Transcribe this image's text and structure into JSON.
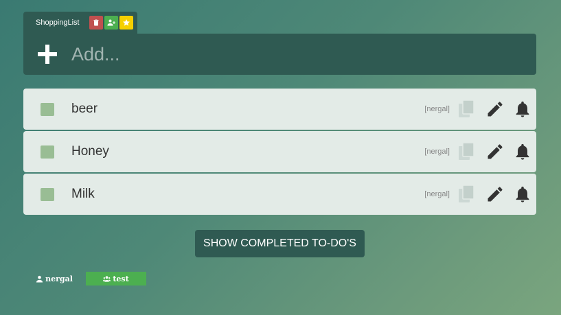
{
  "tab": {
    "title": "ShoppingList",
    "buttons": [
      {
        "name": "delete",
        "icon": "trash-icon",
        "color": "#c0504f"
      },
      {
        "name": "share",
        "icon": "user-plus-icon",
        "color": "#4caf50"
      },
      {
        "name": "favorite",
        "icon": "star-icon",
        "color": "#f5d000"
      }
    ]
  },
  "add": {
    "placeholder": "Add...",
    "icon": "plus-icon"
  },
  "todos": [
    {
      "text": "beer",
      "owner": "[nergal]"
    },
    {
      "text": "Honey",
      "owner": "[nergal]"
    },
    {
      "text": "Milk",
      "owner": "[nergal]"
    }
  ],
  "row_icons": [
    "copy-icon",
    "pencil-icon",
    "bell-icon"
  ],
  "show_completed_label": "SHOW COMPLETED TO-DO'S",
  "footer": {
    "user": {
      "label": "nergal",
      "icon": "user-icon"
    },
    "group": {
      "label": "test",
      "icon": "users-icon",
      "color": "#4caf50"
    }
  },
  "colors": {
    "panel": "#2f5a52",
    "row_bg": "#e3ebe7",
    "checkbox": "#99bd94",
    "accent_green": "#4caf50"
  }
}
